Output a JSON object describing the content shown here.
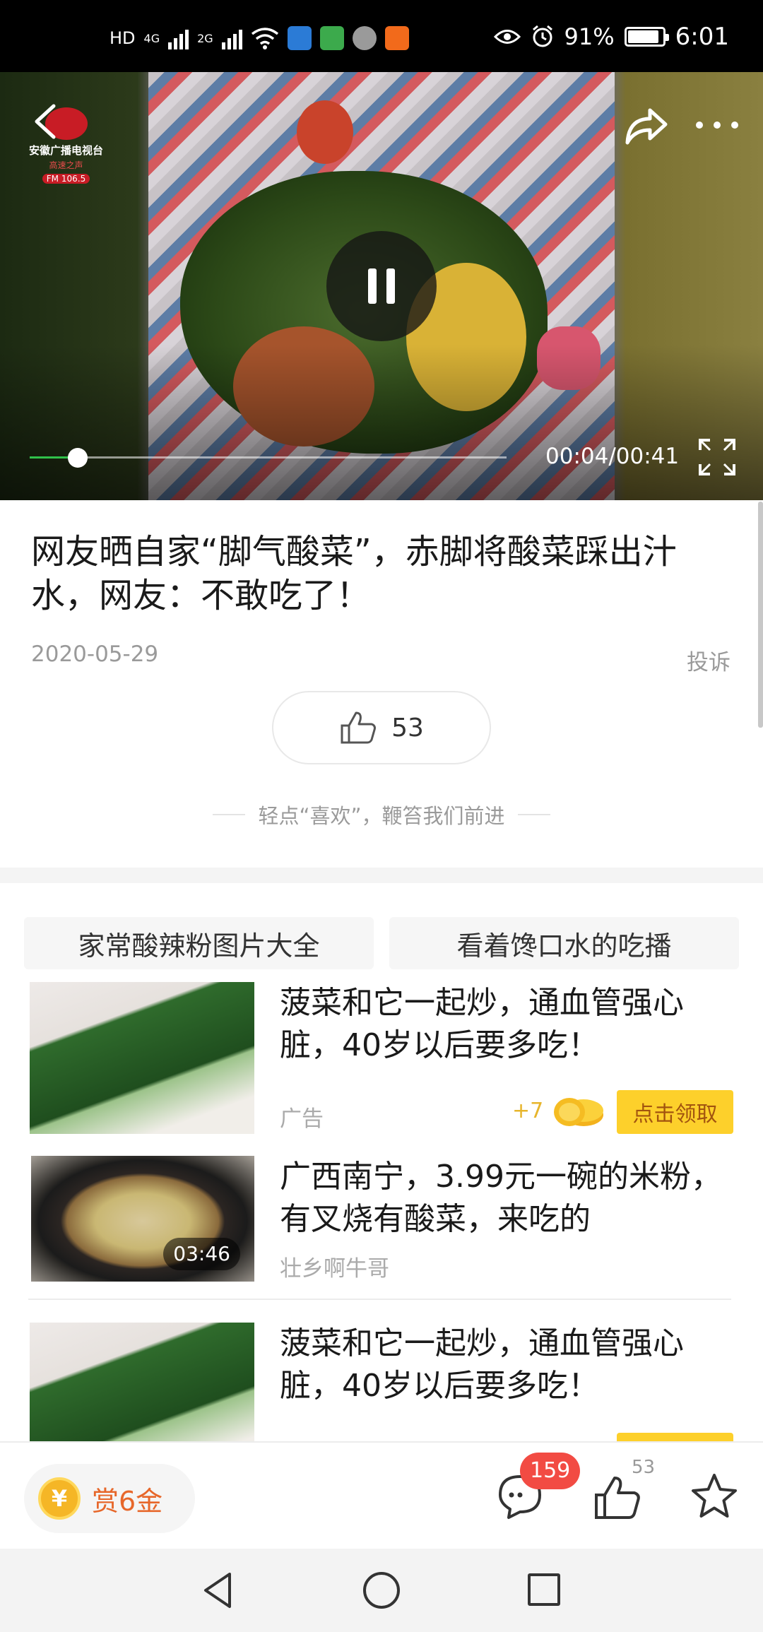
{
  "status_bar": {
    "network_badge": "HD",
    "network_1": "4G",
    "network_2": "2G",
    "battery_percent": "91%",
    "battery_level": 0.91,
    "time": "6:01",
    "icons": [
      "hd-icon",
      "signal-4g-icon",
      "signal-2g-icon",
      "wifi-icon",
      "app-notification-icons",
      "eye-icon",
      "alarm-icon",
      "battery-icon"
    ]
  },
  "video": {
    "watermark": {
      "name": "安徽广播电视台",
      "subtitle": "高速之声",
      "fm": "FM 106.5"
    },
    "time_display": "00:04/00:41",
    "progress": 0.1,
    "state": "playing"
  },
  "article": {
    "title": "网友晒自家“脚气酸菜”，赤脚将酸菜踩出汁水，网友：不敢吃了！",
    "date": "2020-05-29",
    "report_label": "投诉",
    "like_count": "53",
    "encourage_text": "轻点“喜欢”，鞭笞我们前进"
  },
  "tags": [
    "家常酸辣粉图片大全",
    "看着馋口水的吃播"
  ],
  "feed": [
    {
      "title": "菠菜和它一起炒，通血管强心脏，40岁以后要多吃！",
      "meta": "广告",
      "bonus": "+7",
      "cta": "点击领取"
    },
    {
      "title": "广西南宁，3.99元一碗的米粉，有叉烧有酸菜，来吃的",
      "meta": "壮乡啊牛哥",
      "duration": "03:46"
    },
    {
      "title": "菠菜和它一起炒，通血管强心脏，40岁以后要多吃！"
    }
  ],
  "bottom_bar": {
    "reward_label": "赏6金",
    "reward_symbol": "¥",
    "comment_count": "159",
    "like_count": "53"
  },
  "colors": {
    "accent_green": "#30c14a",
    "badge_red": "#f24b43",
    "claim_yellow": "#fdd02b",
    "reward_orange": "#e7672a"
  }
}
